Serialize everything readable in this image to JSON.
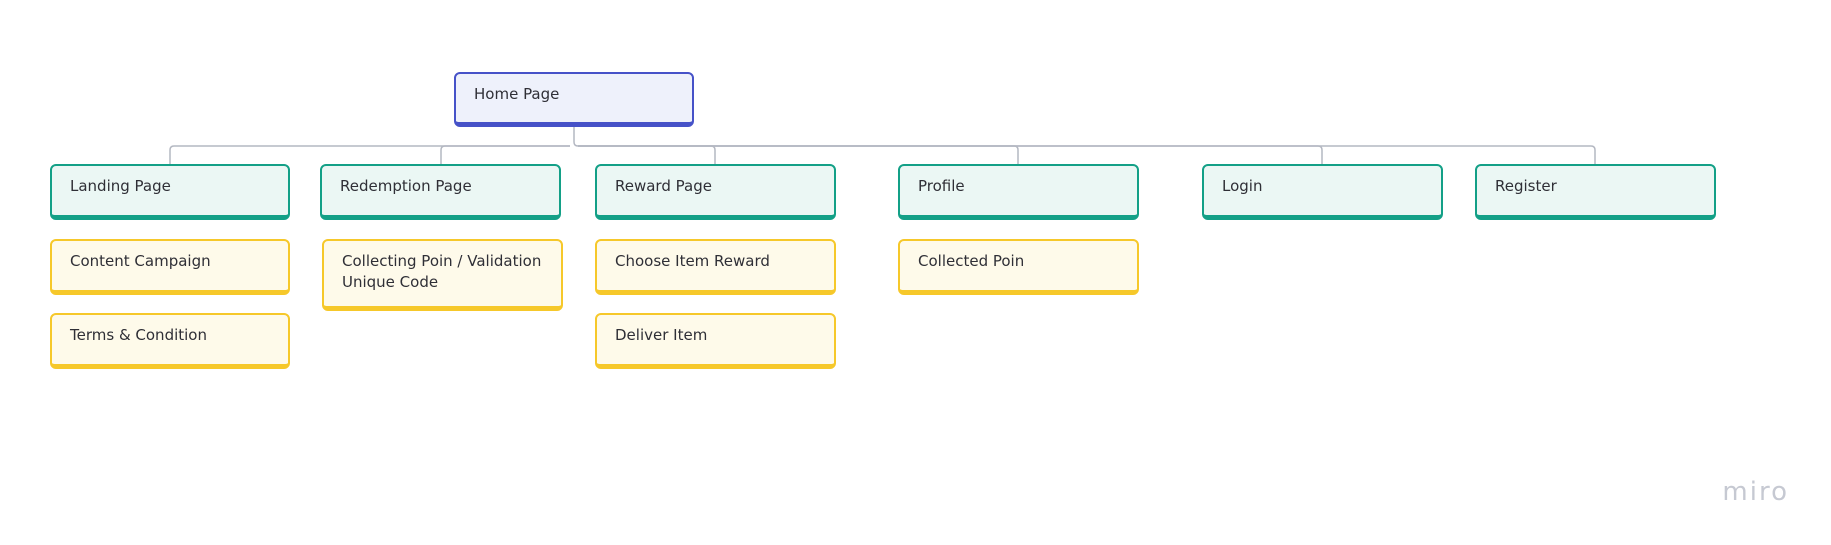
{
  "diagram": {
    "root": {
      "label": "Home Page"
    },
    "pages": [
      {
        "label": "Landing Page",
        "children": [
          "Content Campaign",
          "Terms & Condition"
        ]
      },
      {
        "label": "Redemption Page",
        "children": [
          "Collecting Poin / Validation Unique Code"
        ]
      },
      {
        "label": "Reward Page",
        "children": [
          "Choose Item Reward",
          "Deliver Item"
        ]
      },
      {
        "label": "Profile",
        "children": [
          "Collected Poin"
        ]
      },
      {
        "label": "Login",
        "children": []
      },
      {
        "label": "Register",
        "children": []
      }
    ]
  },
  "colors": {
    "root_border": "#4652c8",
    "root_fill": "#eef1fb",
    "page_border": "#13a087",
    "page_fill": "#ebf7f4",
    "detail_border": "#f6c82a",
    "detail_fill": "#fefaea",
    "connector": "#b4b8c2"
  },
  "watermark": {
    "text": "miro"
  }
}
